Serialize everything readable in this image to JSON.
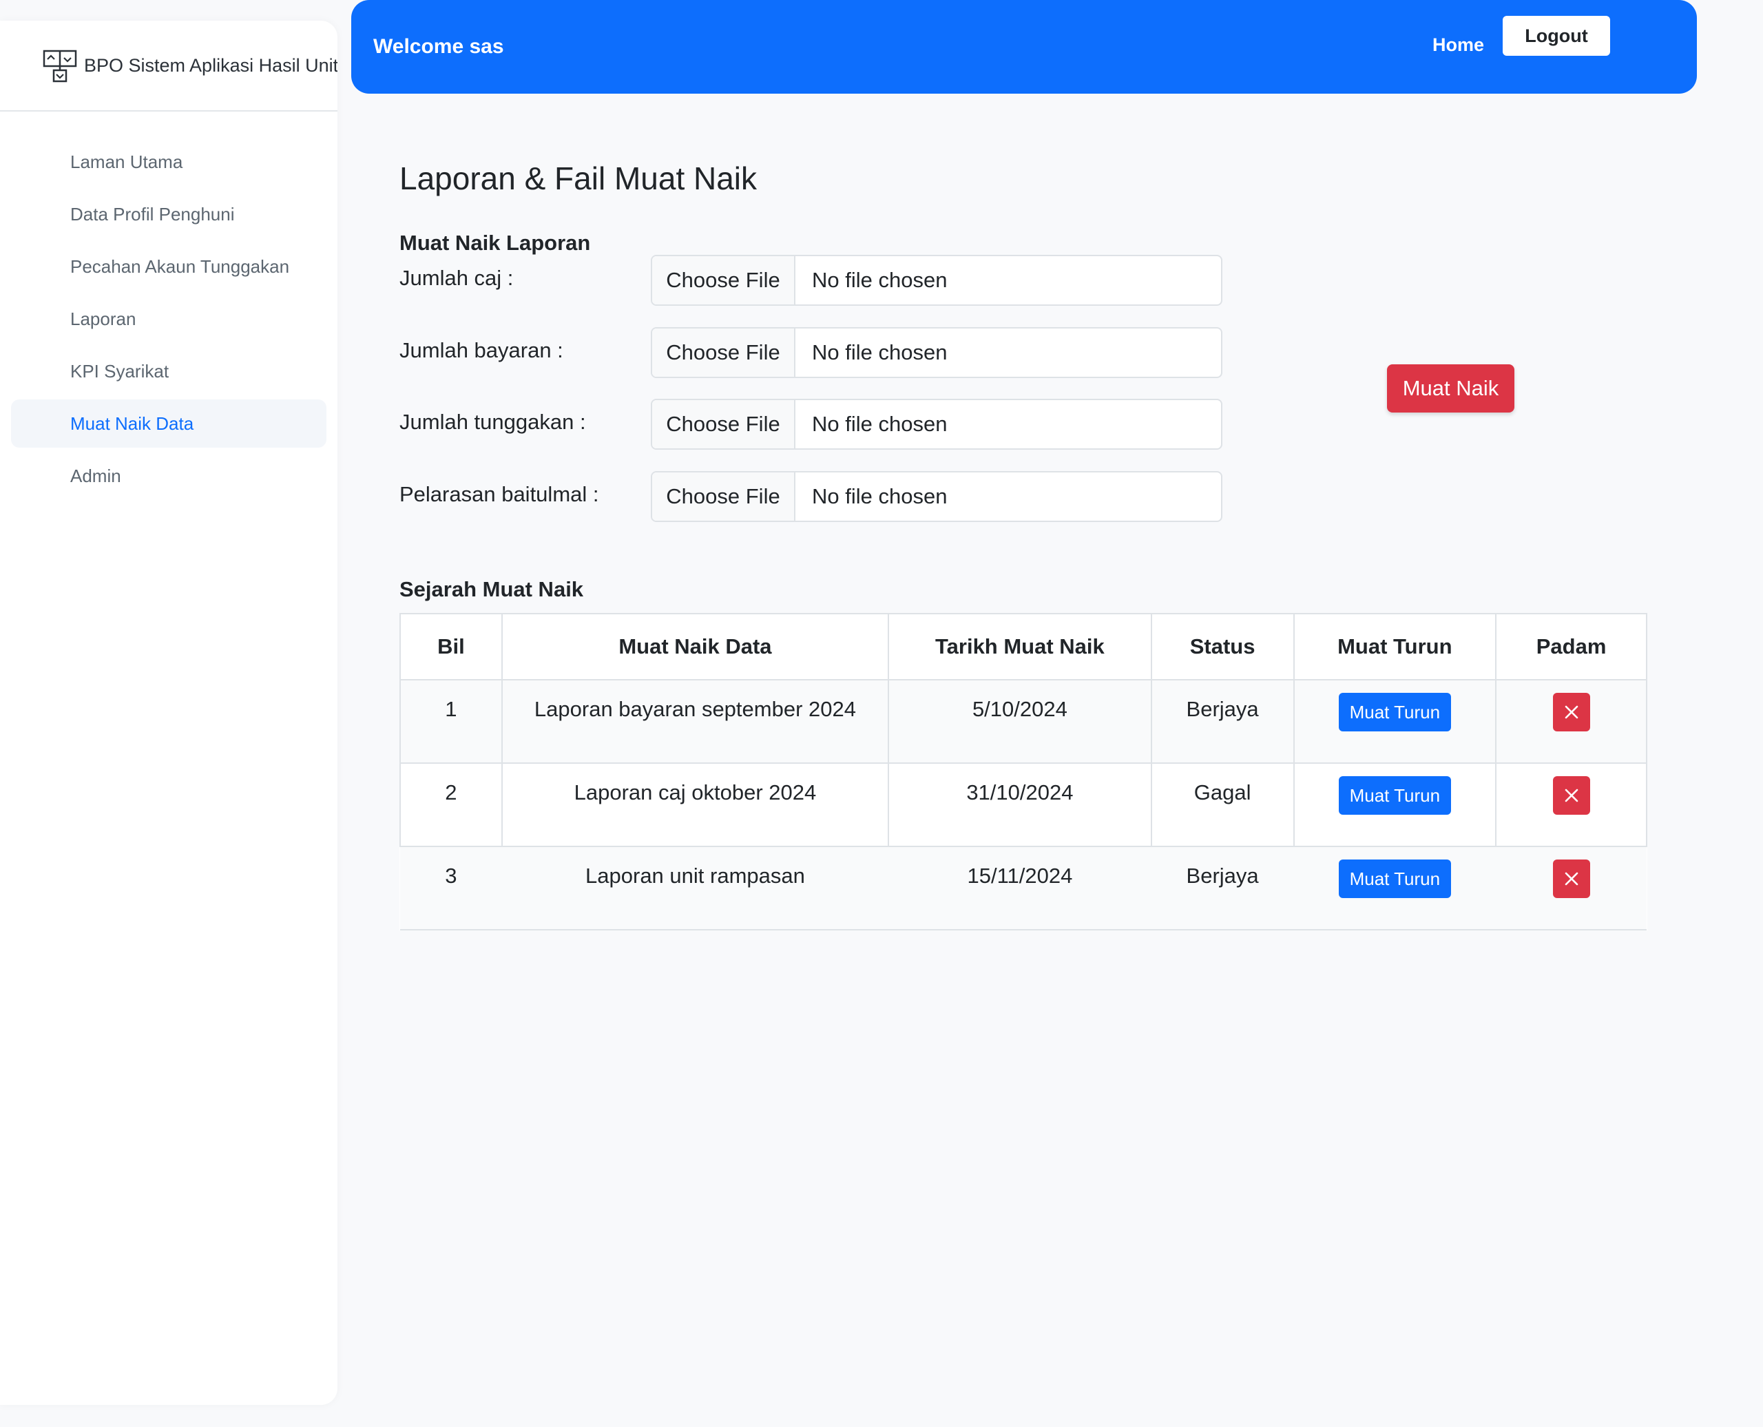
{
  "sidebar": {
    "brand": "BPO Sistem Aplikasi Hasil Unit Aset",
    "brand_icon": "org-chart-icon",
    "items": [
      {
        "label": "Laman Utama",
        "active": false
      },
      {
        "label": "Data Profil Penghuni",
        "active": false
      },
      {
        "label": "Pecahan Akaun Tunggakan",
        "active": false
      },
      {
        "label": "Laporan",
        "active": false
      },
      {
        "label": "KPI Syarikat",
        "active": false
      },
      {
        "label": "Muat Naik Data",
        "active": true
      },
      {
        "label": "Admin",
        "active": false
      }
    ]
  },
  "header": {
    "welcome": "Welcome sas",
    "home": "Home",
    "logout": "Logout",
    "color": "#0d6efd"
  },
  "main": {
    "title": "Laporan & Fail Muat Naik",
    "upload_section": "Muat Naik Laporan",
    "upload_rows": [
      {
        "label": "Jumlah caj :",
        "button": "Choose File",
        "file": "No file chosen"
      },
      {
        "label": "Jumlah bayaran :",
        "button": "Choose File",
        "file": "No file chosen"
      },
      {
        "label": "Jumlah tunggakan :",
        "button": "Choose File",
        "file": "No file chosen"
      },
      {
        "label": "Pelarasan baitulmal :",
        "button": "Choose File",
        "file": "No file chosen"
      }
    ],
    "upload_button": "Muat Naik",
    "history_section": "Sejarah Muat Naik",
    "table": {
      "headers": [
        "Bil",
        "Muat Naik Data",
        "Tarikh Muat Naik",
        "Status",
        "Muat Turun",
        "Padam"
      ],
      "rows": [
        {
          "bil": "1",
          "data": "Laporan bayaran september 2024",
          "date": "5/10/2024",
          "status": "Berjaya",
          "download": "Muat Turun"
        },
        {
          "bil": "2",
          "data": "Laporan caj oktober 2024",
          "date": "31/10/2024",
          "status": "Gagal",
          "download": "Muat Turun"
        },
        {
          "bil": "3",
          "data": "Laporan unit rampasan",
          "date": "15/11/2024",
          "status": "Berjaya",
          "download": "Muat Turun"
        }
      ]
    }
  },
  "colors": {
    "primary": "#0d6efd",
    "danger": "#dc3545"
  }
}
